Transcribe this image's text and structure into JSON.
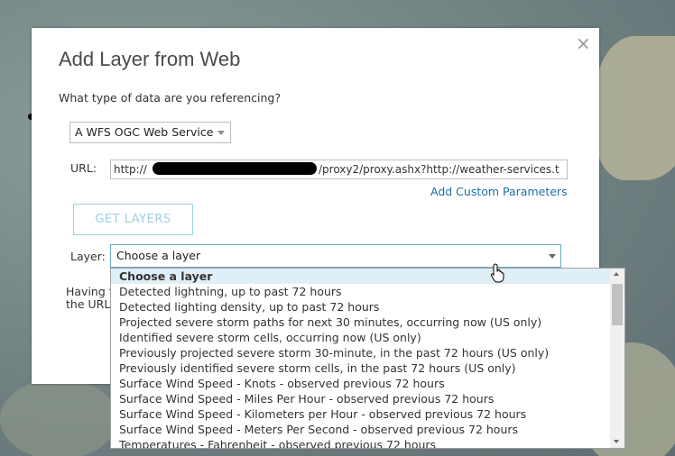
{
  "dialog": {
    "title": "Add Layer from Web",
    "close_glyph": "×",
    "question": "What type of data are you referencing?",
    "type_select_value": "A WFS OGC Web Service",
    "url_label": "URL:",
    "url_value_prefix": "http://",
    "url_value_suffix": "/proxy2/proxy.ashx?http://weather-services.t",
    "add_custom_params": "Add Custom Parameters",
    "get_layers": "GET LAYERS",
    "layer_label": "Layer:",
    "layer_select_value": "Choose a layer",
    "having_line1": "Having t",
    "having_line2": "the URL"
  },
  "dropdown": {
    "options": [
      "Choose a layer",
      "Detected lightning, up to past 72 hours",
      "Detected lighting density, up to past 72 hours",
      "Projected severe storm paths for next 30 minutes, occurring now (US only)",
      "Identified severe storm cells, occurring now (US only)",
      "Previously projected severe storm 30-minute, in the past 72 hours (US only)",
      "Previously identified severe storm cells, in the past 72 hours (US only)",
      "Surface Wind Speed - Knots - observed previous 72 hours",
      "Surface Wind Speed - Miles Per Hour - observed previous 72 hours",
      "Surface Wind Speed - Kilometers per Hour - observed previous 72 hours",
      "Surface Wind Speed - Meters Per Second - observed previous 72 hours",
      "Temperatures - Fahrenheit - observed previous 72 hours"
    ],
    "selected_index": 0
  },
  "colors": {
    "link": "#1b6fa8",
    "button_disabled": "#9fd0e3",
    "selected_option_bg": "#dfeef7"
  },
  "icons": [
    "close-icon",
    "chevron-down-icon",
    "cursor-hand-icon",
    "scroll-up-icon",
    "scroll-down-icon"
  ]
}
